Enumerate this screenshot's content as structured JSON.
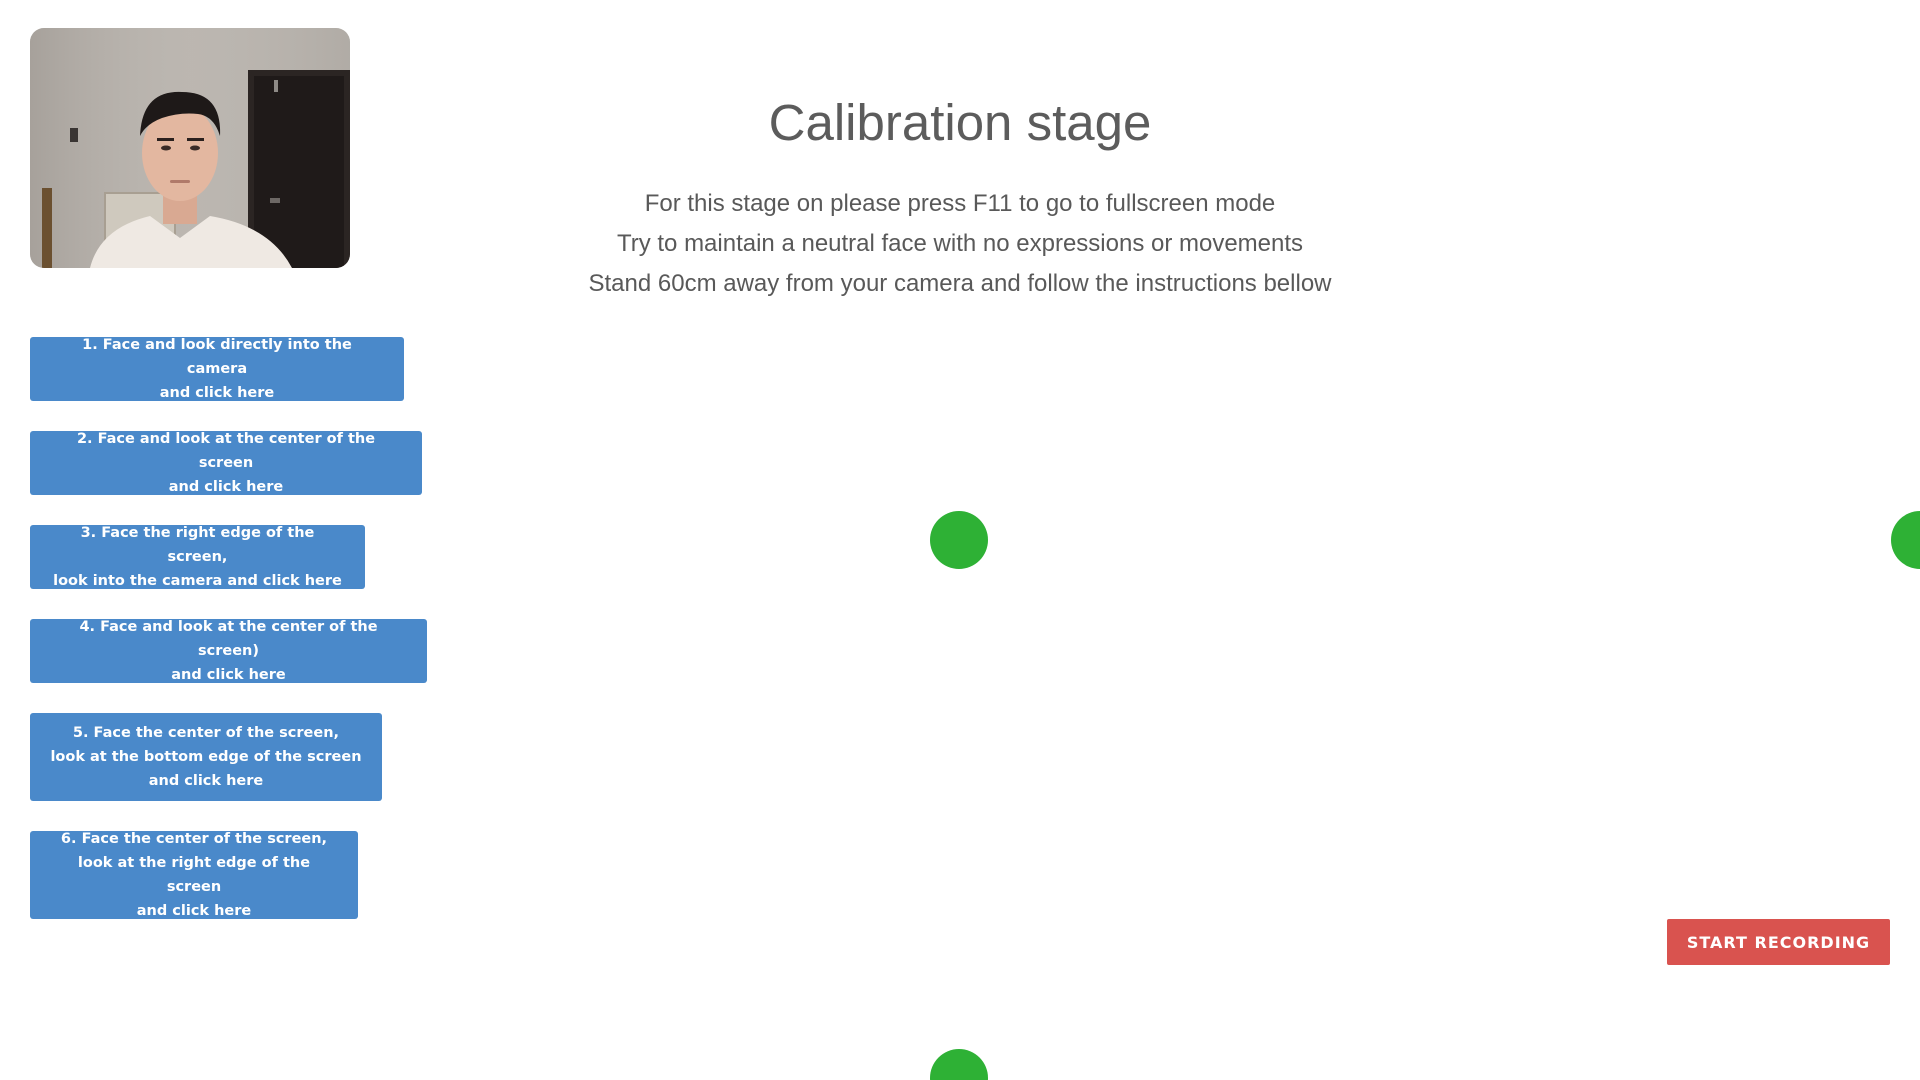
{
  "header": {
    "title": "Calibration stage"
  },
  "instructions": [
    "For this stage on please press F11 to go to fullscreen mode",
    "Try to maintain a neutral face with no expressions or movements",
    "Stand 60cm away from your camera and follow the instructions bellow"
  ],
  "steps": [
    {
      "label": "1. Face and look directly into the camera\nand click here"
    },
    {
      "label": "2. Face and look at the center of the screen\nand click here"
    },
    {
      "label": "3. Face the right edge of the screen,\nlook into the camera and click here"
    },
    {
      "label": "4. Face and look at the center of the screen)\nand click here"
    },
    {
      "label": "5. Face the center of the screen,\nlook at the bottom edge of the screen\nand click here"
    },
    {
      "label": "6. Face the center of the screen,\nlook at the right edge of the screen\nand click here"
    }
  ],
  "record_button": {
    "label": "START RECORDING"
  },
  "colors": {
    "step_button": "#4a89ca",
    "calibration_dot": "#2eb135",
    "record_button": "#d9534f",
    "heading_text": "#5c5c5c"
  },
  "webcam": {
    "icon": "webcam-preview"
  }
}
